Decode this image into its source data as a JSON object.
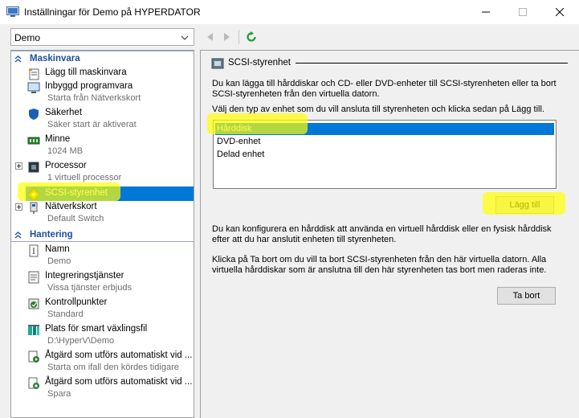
{
  "window": {
    "title": "Inställningar för Demo på HYPERDATOR"
  },
  "vm_select": {
    "value": "Demo"
  },
  "tree": {
    "hardware_header": "Maskinvara",
    "management_header": "Hantering",
    "items": [
      {
        "name": "Lägg till maskinvara",
        "sub": ""
      },
      {
        "name": "Inbyggd programvara",
        "sub": "Starta från Nätverkskort"
      },
      {
        "name": "Säkerhet",
        "sub": "Säker start är aktiverat"
      },
      {
        "name": "Minne",
        "sub": "1024 MB"
      },
      {
        "name": "Processor",
        "sub": "1 virtuell processor"
      },
      {
        "name": "SCSI-styrenhet",
        "sub": ""
      },
      {
        "name": "Nätverkskort",
        "sub": "Default Switch"
      },
      {
        "name": "Namn",
        "sub": "Demo"
      },
      {
        "name": "Integreringstjänster",
        "sub": "Vissa tjänster erbjuds"
      },
      {
        "name": "Kontrollpunkter",
        "sub": "Standard"
      },
      {
        "name": "Plats för smart växlingsfil",
        "sub": "D:\\HyperV\\Demo"
      },
      {
        "name": "Åtgärd som utförs automatiskt vid ...",
        "sub": "Starta om ifall den kördes tidigare"
      },
      {
        "name": "Åtgärd som utförs automatiskt vid ...",
        "sub": "Spara"
      }
    ]
  },
  "panel": {
    "group_title": "SCSI-styrenhet",
    "intro": "Du kan lägga till hårddiskar och CD- eller DVD-enheter till SCSI-styrenheten eller ta bort SCSI-styrenheten från den virtuella datorn.",
    "choose": "Välj den typ av enhet som du vill ansluta till styrenheten och klicka sedan på Lägg till.",
    "device_types": [
      "Hårddisk",
      "DVD-enhet",
      "Delad enhet"
    ],
    "add_button": "Lägg till",
    "configure_text": "Du kan konfigurera en hårddisk att använda en virtuell hårddisk eller en fysisk hårddisk efter att du har anslutit enheten till styrenheten.",
    "remove_text": "Klicka på Ta bort om du vill ta bort SCSI-styrenheten från den här virtuella datorn. Alla virtuella hårddiskar som är anslutna till den här styrenheten tas bort men raderas inte.",
    "remove_button": "Ta bort"
  },
  "colors": {
    "selection": "#0078d7",
    "section_header": "#1f4e9c",
    "highlight": "#ffff00"
  }
}
